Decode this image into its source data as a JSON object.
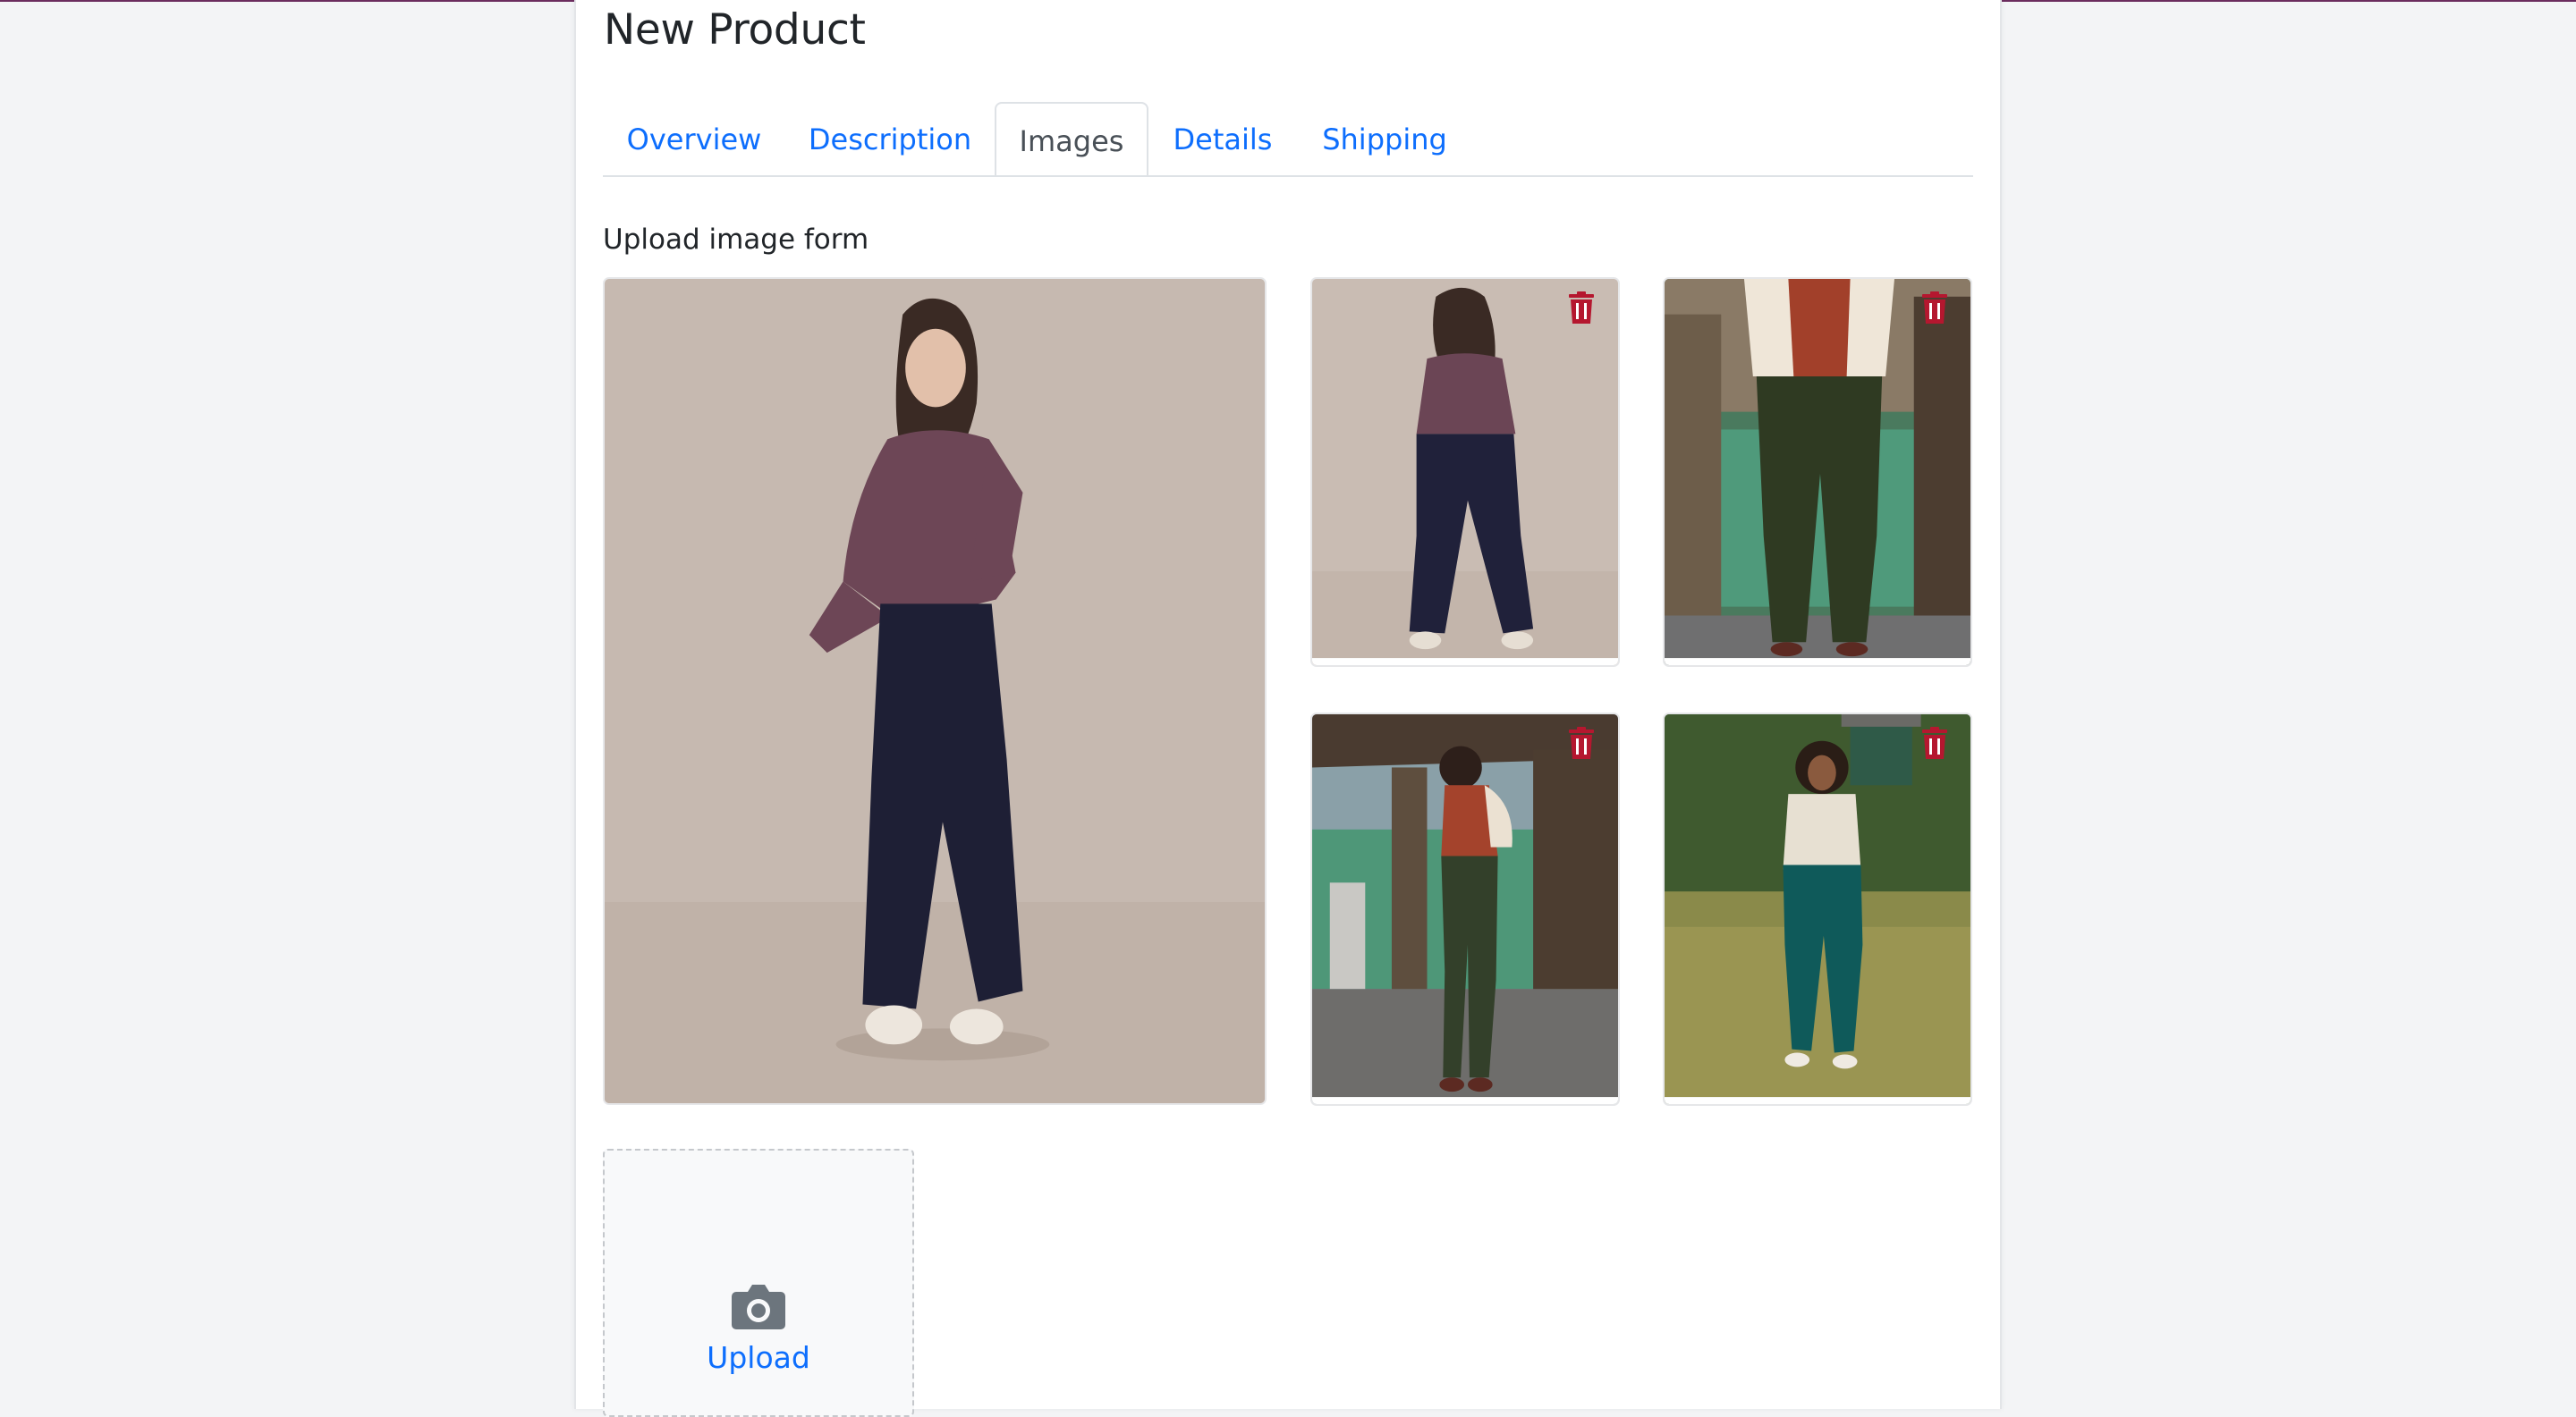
{
  "header": {
    "title": "New Product"
  },
  "tabs": [
    {
      "label": "Overview",
      "active": false
    },
    {
      "label": "Description",
      "active": false
    },
    {
      "label": "Images",
      "active": true
    },
    {
      "label": "Details",
      "active": false
    },
    {
      "label": "Shipping",
      "active": false
    }
  ],
  "images_section": {
    "label": "Upload image form",
    "images": [
      {
        "name": "studio-front-burgundy-top-navy-pants",
        "primary": true
      },
      {
        "name": "studio-back-burgundy-top-navy-pants",
        "primary": false
      },
      {
        "name": "pier-dark-green-pants-closeup",
        "primary": false
      },
      {
        "name": "pier-dark-green-pants-full",
        "primary": false
      },
      {
        "name": "meadow-teal-pants",
        "primary": false
      }
    ],
    "upload_label": "Upload"
  },
  "colors": {
    "accent": "#0d6efd",
    "delete_icon": "#b5172f",
    "top_border": "#6b2c5e"
  },
  "icons": {
    "delete": "trash-icon",
    "upload": "camera-icon"
  }
}
